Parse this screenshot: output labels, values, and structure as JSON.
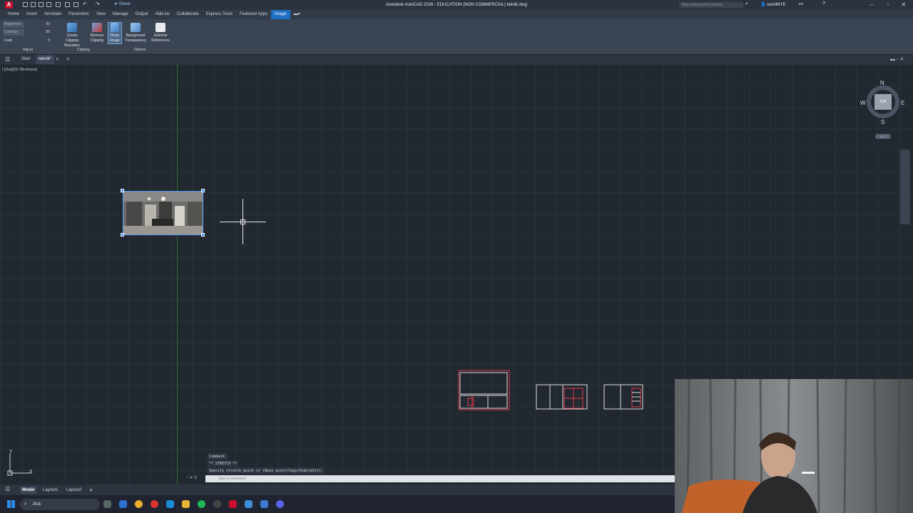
{
  "app": {
    "title": "Autodesk AutoCAD 2026 - EDUCATION (NON COMMERCIAL)   teknik.dwg",
    "share_label": "Share",
    "search_placeholder": "Type a keyword or phrase",
    "username": "cemilNYE"
  },
  "ribbon_tabs": [
    "Home",
    "Insert",
    "Annotate",
    "Parametric",
    "View",
    "Manage",
    "Output",
    "Add-ins",
    "Collaborate",
    "Express Tools",
    "Featured Apps",
    "Image"
  ],
  "active_tab": "Image",
  "ribbon": {
    "adjust": {
      "brightness_label": "Brightness",
      "brightness_value": "50",
      "contrast_label": "Contrast",
      "contrast_value": "50",
      "fade_label": "Fade",
      "fade_value": "0",
      "panel_label": "Adjust"
    },
    "clipping": {
      "create_label": "Create Clipping Boundary",
      "remove_label": "Remove Clipping",
      "panel_label": "Clipping"
    },
    "options": {
      "show_image_label": "Show Image",
      "background_label": "Background Transparency",
      "external_label": "External References",
      "panel_label": "Options"
    }
  },
  "doc_tabs": {
    "start": "Start",
    "file": "teknik*"
  },
  "viewport_label": "[-][Top][2D Wireframe]",
  "viewcube": {
    "n": "N",
    "s": "S",
    "e": "E",
    "w": "W",
    "top": "TOP",
    "wcs": "WCS"
  },
  "command": {
    "history": [
      "Command:",
      "** STRETCH **",
      "Specify stretch point or [Base point/Copy/Undo/eXit]:"
    ],
    "placeholder": "Type a command"
  },
  "layout_tabs": [
    "Model",
    "Layout1",
    "Layout2"
  ],
  "taskbar": {
    "search_label": "Ara"
  },
  "ucs": {
    "x": "X",
    "y": "Y"
  },
  "colors": {
    "accent": "#1d70c2",
    "drawing_lines": "#e33a4a",
    "grip": "#3b8cff"
  }
}
